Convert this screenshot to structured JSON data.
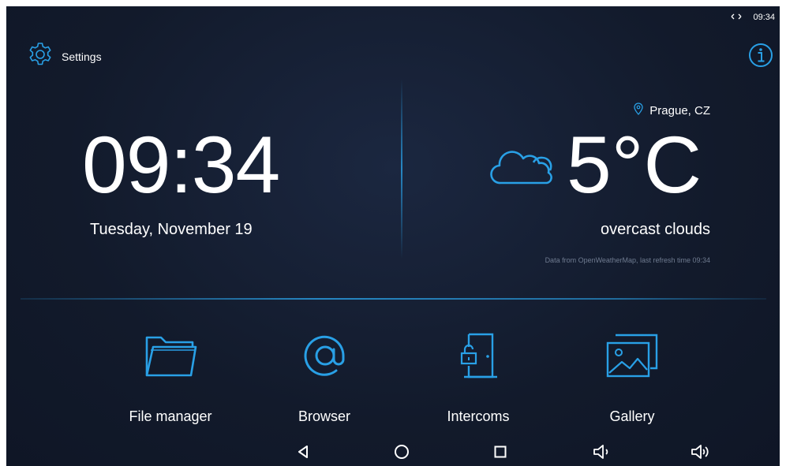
{
  "status_bar": {
    "network_icon": "swap-horizontal-icon",
    "time": "09:34"
  },
  "settings": {
    "icon": "gear-icon",
    "label": "Settings"
  },
  "info_button": {
    "icon": "info-icon"
  },
  "clock": {
    "time": "09:34",
    "date": "Tuesday, November 19"
  },
  "weather": {
    "location": "Prague, CZ",
    "location_icon": "location-pin-icon",
    "icon": "cloud-icon",
    "temperature": "5°C",
    "description": "overcast clouds",
    "source": "Data from OpenWeatherMap, last refresh time 09:34"
  },
  "apps": [
    {
      "label": "File manager",
      "icon": "folder-icon"
    },
    {
      "label": "Browser",
      "icon": "at-sign-icon"
    },
    {
      "label": "Intercoms",
      "icon": "door-lock-icon"
    },
    {
      "label": "Gallery",
      "icon": "image-gallery-icon"
    }
  ],
  "nav_bar": [
    {
      "icon": "back-triangle-icon"
    },
    {
      "icon": "home-circle-icon"
    },
    {
      "icon": "recents-square-icon"
    },
    {
      "icon": "volume-down-icon"
    },
    {
      "icon": "volume-up-icon"
    }
  ],
  "colors": {
    "accent": "#29a0e6",
    "background": "#141c2e",
    "text": "#ffffff",
    "muted": "#6f7b90"
  }
}
